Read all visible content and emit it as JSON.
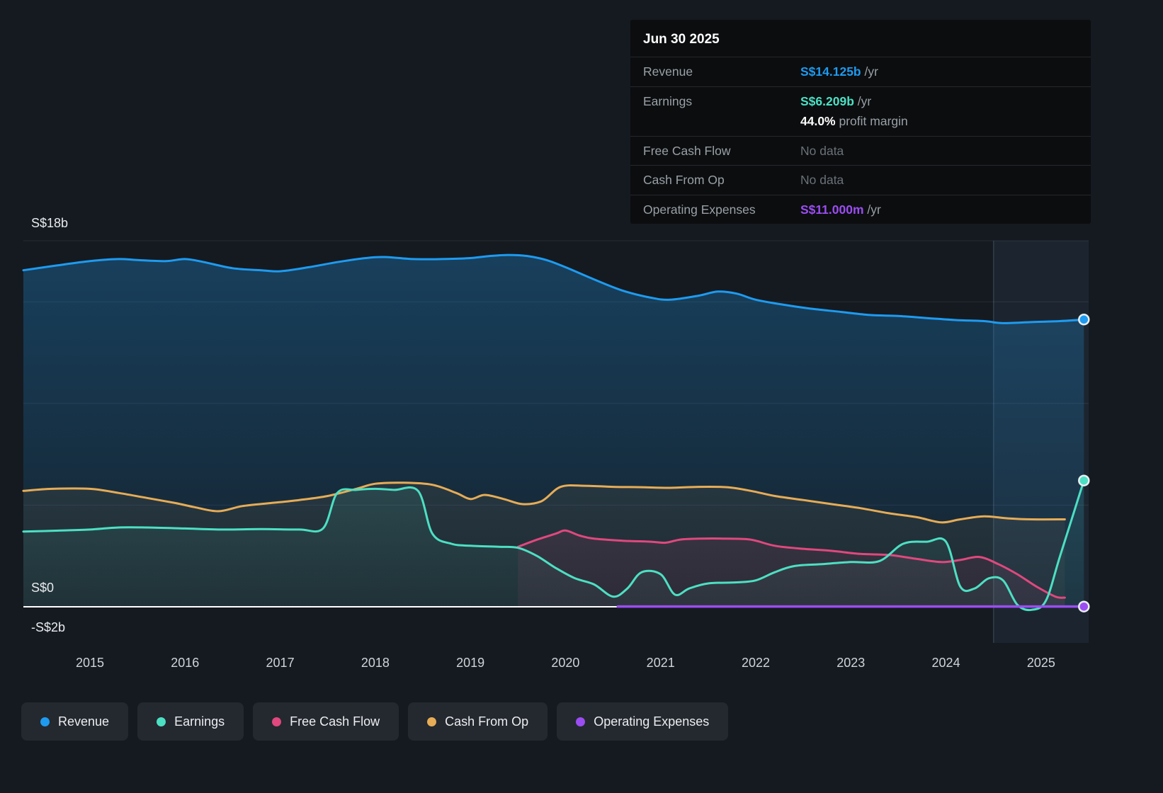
{
  "tooltip": {
    "date": "Jun 30 2025",
    "revenue": {
      "label": "Revenue",
      "value": "S$14.125b",
      "per": " /yr"
    },
    "earnings": {
      "label": "Earnings",
      "value": "S$6.209b",
      "per": " /yr",
      "margin_value": "44.0%",
      "margin_text": " profit margin"
    },
    "free_cash_flow": {
      "label": "Free Cash Flow",
      "value": "No data"
    },
    "cash_from_op": {
      "label": "Cash From Op",
      "value": "No data"
    },
    "operating_expenses": {
      "label": "Operating Expenses",
      "value": "S$11.000m",
      "per": " /yr"
    }
  },
  "chart_data": {
    "type": "area",
    "unit": "S$ billions per year",
    "x_ticks": [
      2015,
      2016,
      2017,
      2018,
      2019,
      2020,
      2021,
      2022,
      2023,
      2024,
      2025
    ],
    "x_range": [
      2014.3,
      2025.5
    ],
    "ylim": [
      -2,
      18
    ],
    "y_gridlines": [
      18,
      15,
      10,
      5,
      0
    ],
    "y_axis_labels": [
      {
        "text": "S$18b",
        "value": 18
      },
      {
        "text": "S$0",
        "value": 0
      },
      {
        "text": "-S$2b",
        "value": -2
      }
    ],
    "highlight_from": 2024.5,
    "legend_position": "bottom",
    "grid": true,
    "series": [
      {
        "name": "Revenue",
        "key": "revenue",
        "color": "#1e9bf0",
        "end_marker": true,
        "area": true,
        "points": [
          [
            2014.3,
            16.55
          ],
          [
            2014.6,
            16.75
          ],
          [
            2015.0,
            17.0
          ],
          [
            2015.3,
            17.1
          ],
          [
            2015.5,
            17.05
          ],
          [
            2015.8,
            17.0
          ],
          [
            2016.0,
            17.1
          ],
          [
            2016.2,
            16.95
          ],
          [
            2016.5,
            16.65
          ],
          [
            2016.8,
            16.55
          ],
          [
            2017.0,
            16.5
          ],
          [
            2017.3,
            16.7
          ],
          [
            2017.6,
            16.95
          ],
          [
            2017.9,
            17.15
          ],
          [
            2018.1,
            17.2
          ],
          [
            2018.4,
            17.1
          ],
          [
            2018.7,
            17.1
          ],
          [
            2019.0,
            17.15
          ],
          [
            2019.2,
            17.25
          ],
          [
            2019.4,
            17.3
          ],
          [
            2019.6,
            17.25
          ],
          [
            2019.8,
            17.05
          ],
          [
            2020.0,
            16.7
          ],
          [
            2020.3,
            16.1
          ],
          [
            2020.6,
            15.55
          ],
          [
            2020.9,
            15.2
          ],
          [
            2021.1,
            15.1
          ],
          [
            2021.4,
            15.3
          ],
          [
            2021.6,
            15.5
          ],
          [
            2021.8,
            15.4
          ],
          [
            2022.0,
            15.1
          ],
          [
            2022.3,
            14.85
          ],
          [
            2022.6,
            14.65
          ],
          [
            2022.9,
            14.5
          ],
          [
            2023.2,
            14.35
          ],
          [
            2023.5,
            14.3
          ],
          [
            2023.8,
            14.2
          ],
          [
            2024.1,
            14.1
          ],
          [
            2024.4,
            14.05
          ],
          [
            2024.6,
            13.95
          ],
          [
            2024.9,
            14.0
          ],
          [
            2025.2,
            14.05
          ],
          [
            2025.45,
            14.125
          ]
        ]
      },
      {
        "name": "Earnings",
        "key": "earnings",
        "color": "#4ce0c3",
        "end_marker": true,
        "area": true,
        "points": [
          [
            2014.3,
            3.7
          ],
          [
            2014.7,
            3.75
          ],
          [
            2015.0,
            3.8
          ],
          [
            2015.3,
            3.9
          ],
          [
            2015.6,
            3.9
          ],
          [
            2016.0,
            3.85
          ],
          [
            2016.4,
            3.8
          ],
          [
            2016.8,
            3.82
          ],
          [
            2017.2,
            3.8
          ],
          [
            2017.45,
            3.85
          ],
          [
            2017.6,
            5.6
          ],
          [
            2017.8,
            5.75
          ],
          [
            2018.0,
            5.8
          ],
          [
            2018.2,
            5.75
          ],
          [
            2018.45,
            5.7
          ],
          [
            2018.6,
            3.6
          ],
          [
            2018.8,
            3.1
          ],
          [
            2019.0,
            3.0
          ],
          [
            2019.3,
            2.95
          ],
          [
            2019.5,
            2.9
          ],
          [
            2019.7,
            2.5
          ],
          [
            2019.9,
            1.9
          ],
          [
            2020.1,
            1.4
          ],
          [
            2020.3,
            1.1
          ],
          [
            2020.5,
            0.5
          ],
          [
            2020.65,
            0.9
          ],
          [
            2020.8,
            1.7
          ],
          [
            2021.0,
            1.6
          ],
          [
            2021.15,
            0.6
          ],
          [
            2021.3,
            0.9
          ],
          [
            2021.5,
            1.15
          ],
          [
            2021.8,
            1.2
          ],
          [
            2022.0,
            1.3
          ],
          [
            2022.2,
            1.7
          ],
          [
            2022.4,
            2.0
          ],
          [
            2022.7,
            2.1
          ],
          [
            2023.0,
            2.2
          ],
          [
            2023.3,
            2.25
          ],
          [
            2023.55,
            3.1
          ],
          [
            2023.8,
            3.2
          ],
          [
            2024.0,
            3.2
          ],
          [
            2024.15,
            1.0
          ],
          [
            2024.3,
            0.9
          ],
          [
            2024.45,
            1.4
          ],
          [
            2024.6,
            1.3
          ],
          [
            2024.75,
            0.1
          ],
          [
            2024.9,
            -0.15
          ],
          [
            2025.05,
            0.3
          ],
          [
            2025.2,
            2.5
          ],
          [
            2025.45,
            6.209
          ]
        ]
      },
      {
        "name": "Free Cash Flow",
        "key": "free_cash_flow",
        "color": "#e0487e",
        "end_marker": false,
        "area": true,
        "points": [
          [
            2019.5,
            2.95
          ],
          [
            2019.7,
            3.3
          ],
          [
            2019.9,
            3.6
          ],
          [
            2020.0,
            3.75
          ],
          [
            2020.15,
            3.5
          ],
          [
            2020.3,
            3.35
          ],
          [
            2020.6,
            3.25
          ],
          [
            2020.9,
            3.2
          ],
          [
            2021.05,
            3.15
          ],
          [
            2021.2,
            3.3
          ],
          [
            2021.4,
            3.35
          ],
          [
            2021.7,
            3.35
          ],
          [
            2021.95,
            3.3
          ],
          [
            2022.2,
            3.0
          ],
          [
            2022.5,
            2.85
          ],
          [
            2022.8,
            2.75
          ],
          [
            2023.1,
            2.6
          ],
          [
            2023.4,
            2.55
          ],
          [
            2023.7,
            2.35
          ],
          [
            2023.95,
            2.2
          ],
          [
            2024.15,
            2.3
          ],
          [
            2024.35,
            2.45
          ],
          [
            2024.55,
            2.1
          ],
          [
            2024.75,
            1.6
          ],
          [
            2024.95,
            1.0
          ],
          [
            2025.15,
            0.5
          ],
          [
            2025.25,
            0.45
          ]
        ]
      },
      {
        "name": "Cash From Op",
        "key": "cash_from_op",
        "color": "#e6ac56",
        "end_marker": false,
        "area": true,
        "points": [
          [
            2014.3,
            5.7
          ],
          [
            2014.6,
            5.8
          ],
          [
            2015.0,
            5.8
          ],
          [
            2015.3,
            5.6
          ],
          [
            2015.6,
            5.35
          ],
          [
            2015.9,
            5.1
          ],
          [
            2016.1,
            4.9
          ],
          [
            2016.35,
            4.7
          ],
          [
            2016.6,
            4.95
          ],
          [
            2016.9,
            5.1
          ],
          [
            2017.2,
            5.25
          ],
          [
            2017.5,
            5.45
          ],
          [
            2017.8,
            5.8
          ],
          [
            2018.0,
            6.05
          ],
          [
            2018.3,
            6.1
          ],
          [
            2018.6,
            6.0
          ],
          [
            2018.85,
            5.6
          ],
          [
            2019.0,
            5.3
          ],
          [
            2019.15,
            5.5
          ],
          [
            2019.35,
            5.3
          ],
          [
            2019.55,
            5.05
          ],
          [
            2019.75,
            5.2
          ],
          [
            2019.95,
            5.9
          ],
          [
            2020.2,
            5.95
          ],
          [
            2020.5,
            5.9
          ],
          [
            2020.8,
            5.88
          ],
          [
            2021.1,
            5.85
          ],
          [
            2021.4,
            5.9
          ],
          [
            2021.7,
            5.88
          ],
          [
            2021.95,
            5.7
          ],
          [
            2022.2,
            5.45
          ],
          [
            2022.5,
            5.25
          ],
          [
            2022.8,
            5.05
          ],
          [
            2023.1,
            4.85
          ],
          [
            2023.4,
            4.6
          ],
          [
            2023.7,
            4.4
          ],
          [
            2023.95,
            4.15
          ],
          [
            2024.15,
            4.3
          ],
          [
            2024.4,
            4.45
          ],
          [
            2024.65,
            4.35
          ],
          [
            2024.9,
            4.3
          ],
          [
            2025.25,
            4.3
          ]
        ]
      },
      {
        "name": "Operating Expenses",
        "key": "operating_expenses",
        "color": "#9c4df2",
        "end_marker": true,
        "area": false,
        "points": [
          [
            2020.55,
            0.011
          ],
          [
            2025.45,
            0.011
          ]
        ]
      }
    ]
  }
}
